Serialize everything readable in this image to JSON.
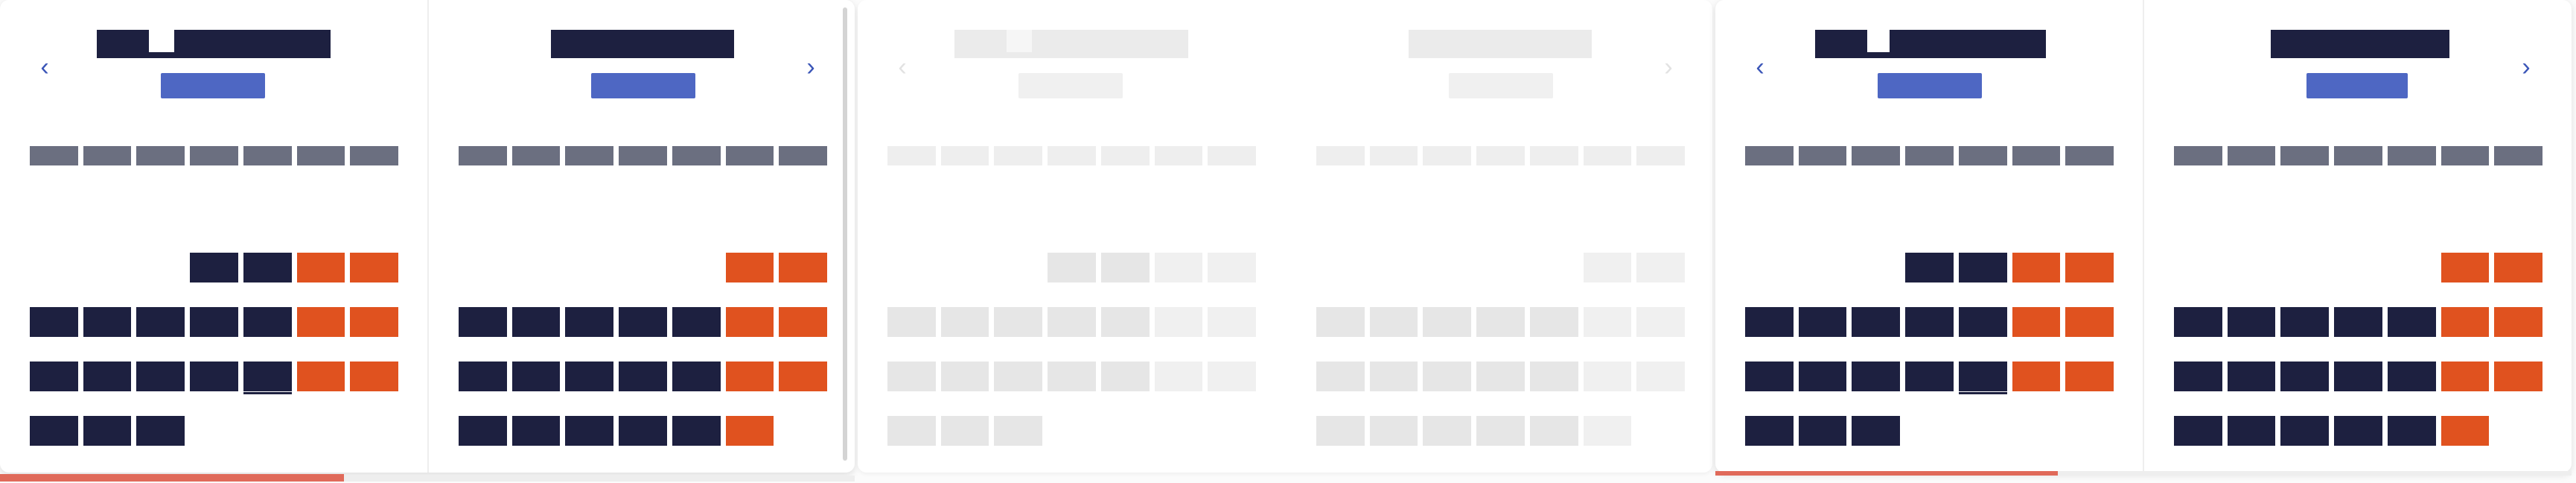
{
  "nav": {
    "prev_label": "‹",
    "next_label": "›",
    "prev_icon": "chevron-left-icon",
    "next_icon": "chevron-right-icon"
  },
  "colors": {
    "header": "#1d2040",
    "year": "#4e67c3",
    "weekday": "#6b6f80",
    "weekend": "#e0521f",
    "nav": "#3a55b7",
    "underline": "#e06a5a"
  },
  "weekday_labels": [
    "",
    "",
    "",
    "",
    "",
    "",
    ""
  ],
  "panels": [
    {
      "state": "active",
      "months": [
        {
          "title": "",
          "year": "",
          "days": [
            "",
            "",
            "",
            "",
            "",
            "",
            "",
            "",
            "",
            "",
            "",
            "",
            "",
            "",
            "",
            "",
            "",
            "",
            "",
            "",
            "",
            "",
            "",
            "",
            "",
            "",
            "",
            "",
            "",
            "",
            ""
          ]
        },
        {
          "title": "",
          "year": "",
          "days": [
            "",
            "",
            "",
            "",
            "",
            "",
            "",
            "",
            "",
            "",
            "",
            "",
            "",
            "",
            "",
            "",
            "",
            "",
            "",
            "",
            "",
            "",
            "",
            "",
            "",
            "",
            "",
            "",
            "",
            "",
            "",
            "",
            "",
            ""
          ]
        }
      ]
    },
    {
      "state": "transition",
      "months": [
        {
          "title": "",
          "year": "",
          "days": [
            "",
            "",
            "",
            "",
            "",
            "",
            "",
            "",
            "",
            "",
            "",
            "",
            "",
            "",
            "",
            "",
            "",
            "",
            "",
            "",
            "",
            "",
            "",
            "",
            "",
            "",
            "",
            "",
            "",
            "",
            ""
          ]
        },
        {
          "title": "",
          "year": "",
          "days": [
            "",
            "",
            "",
            "",
            "",
            "",
            "",
            "",
            "",
            "",
            "",
            "",
            "",
            "",
            "",
            "",
            "",
            "",
            "",
            "",
            "",
            "",
            "",
            "",
            "",
            "",
            "",
            "",
            "",
            "",
            "",
            "",
            "",
            ""
          ]
        }
      ]
    },
    {
      "state": "active",
      "months": [
        {
          "title": "",
          "year": "",
          "days": [
            "",
            "",
            "",
            "",
            "",
            "",
            "",
            "",
            "",
            "",
            "",
            "",
            "",
            "",
            "",
            "",
            "",
            "",
            "",
            "",
            "",
            "",
            "",
            "",
            "",
            "",
            "",
            "",
            "",
            "",
            ""
          ]
        },
        {
          "title": "",
          "year": "",
          "days": [
            "",
            "",
            "",
            "",
            "",
            "",
            "",
            "",
            "",
            "",
            "",
            "",
            "",
            "",
            "",
            "",
            "",
            "",
            "",
            "",
            "",
            "",
            "",
            "",
            "",
            "",
            "",
            "",
            "",
            "",
            "",
            "",
            "",
            ""
          ]
        }
      ]
    }
  ]
}
